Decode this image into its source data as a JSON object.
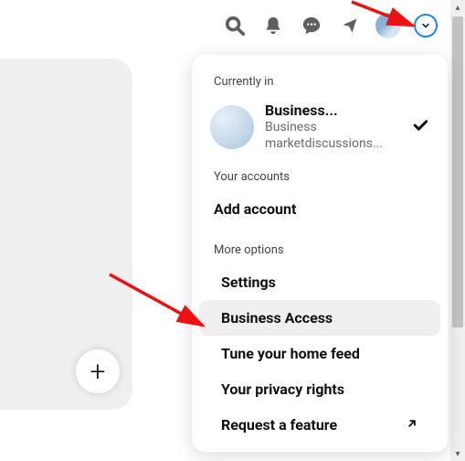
{
  "dropdown": {
    "section_current": "Currently in",
    "account": {
      "name": "Business...",
      "type": "Business",
      "handle": "marketdiscussions..."
    },
    "section_accounts": "Your accounts",
    "add_account": "Add account",
    "section_more": "More options",
    "items": [
      {
        "label": "Settings"
      },
      {
        "label": "Business Access"
      },
      {
        "label": "Tune your home feed"
      },
      {
        "label": "Your privacy rights"
      },
      {
        "label": "Request a feature"
      }
    ]
  }
}
